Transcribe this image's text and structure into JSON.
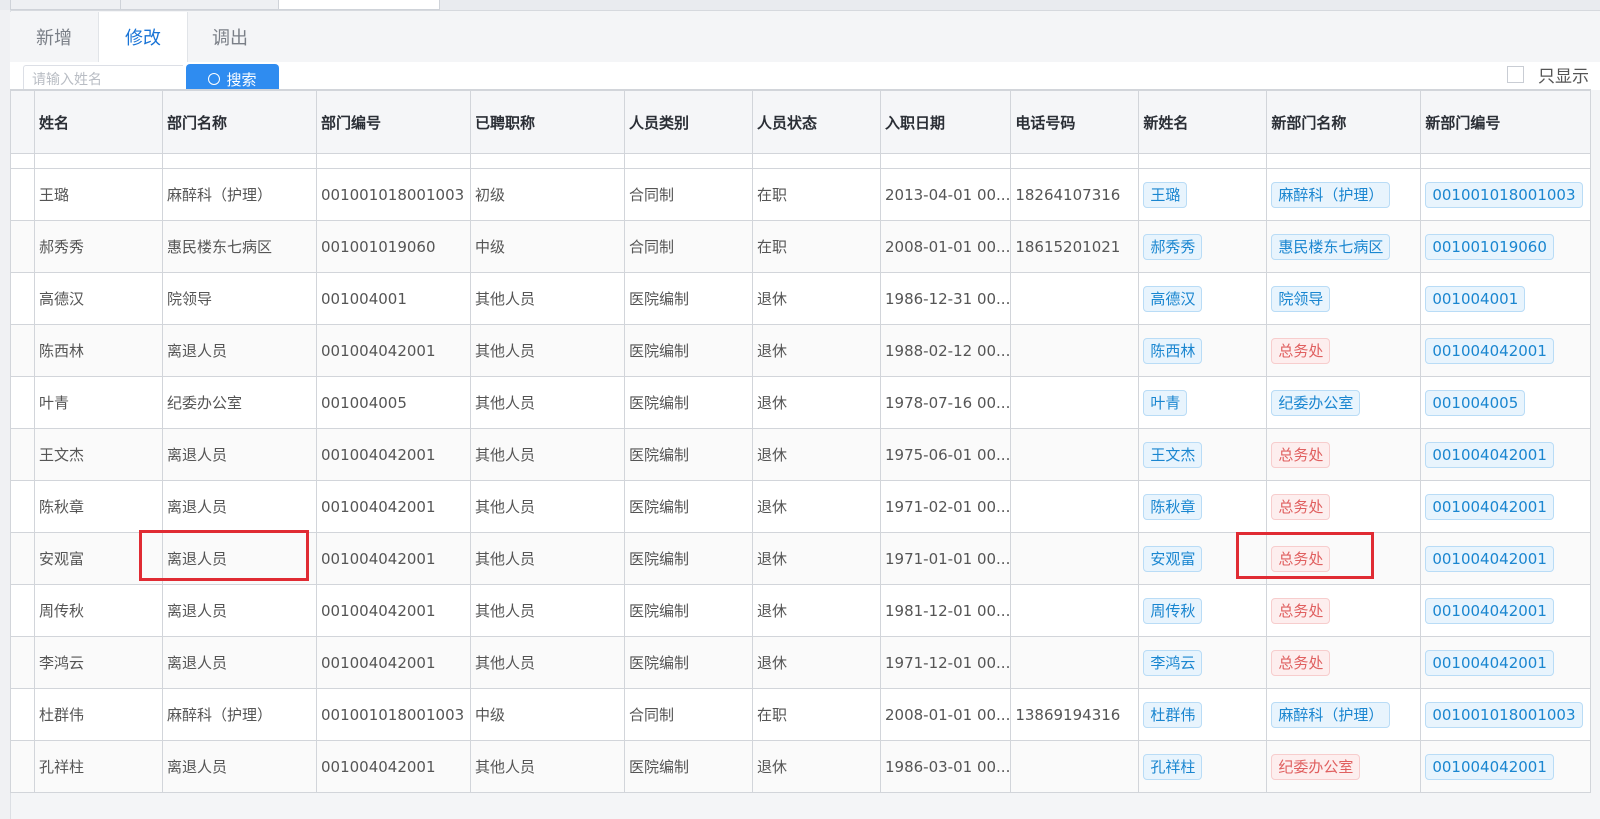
{
  "tabs": [
    {
      "label": "新增",
      "active": false
    },
    {
      "label": "修改",
      "active": true
    },
    {
      "label": "调出",
      "active": false
    }
  ],
  "search": {
    "placeholder": "请输入姓名",
    "button_label": "搜索",
    "only_show_label": "只显示"
  },
  "columns": [
    "姓名",
    "部门名称",
    "部门编号",
    "已聘职称",
    "人员类别",
    "人员状态",
    "入职日期",
    "电话号码",
    "新姓名",
    "新部门名称",
    "新部门编号"
  ],
  "rows": [
    {
      "name": "王璐",
      "dept": "麻醉科（护理）",
      "dept_no": "001001018001003",
      "title": "初级",
      "category": "合同制",
      "status": "在职",
      "date": "2013-04-01 00...",
      "phone": "18264107316",
      "new_name": "王璐",
      "new_dept": "麻醉科（护理）",
      "new_dept_no": "001001018001003",
      "new_dept_color": "blue"
    },
    {
      "name": "郝秀秀",
      "dept": "惠民楼东七病区",
      "dept_no": "001001019060",
      "title": "中级",
      "category": "合同制",
      "status": "在职",
      "date": "2008-01-01 00...",
      "phone": "18615201021",
      "new_name": "郝秀秀",
      "new_dept": "惠民楼东七病区",
      "new_dept_no": "001001019060",
      "new_dept_color": "blue"
    },
    {
      "name": "高德汉",
      "dept": "院领导",
      "dept_no": "001004001",
      "title": "其他人员",
      "category": "医院编制",
      "status": "退休",
      "date": "1986-12-31 00...",
      "phone": "",
      "new_name": "高德汉",
      "new_dept": "院领导",
      "new_dept_no": "001004001",
      "new_dept_color": "blue"
    },
    {
      "name": "陈西林",
      "dept": "离退人员",
      "dept_no": "001004042001",
      "title": "其他人员",
      "category": "医院编制",
      "status": "退休",
      "date": "1988-02-12 00...",
      "phone": "",
      "new_name": "陈西林",
      "new_dept": "总务处",
      "new_dept_no": "001004042001",
      "new_dept_color": "red"
    },
    {
      "name": "叶青",
      "dept": "纪委办公室",
      "dept_no": "001004005",
      "title": "其他人员",
      "category": "医院编制",
      "status": "退休",
      "date": "1978-07-16 00...",
      "phone": "",
      "new_name": "叶青",
      "new_dept": "纪委办公室",
      "new_dept_no": "001004005",
      "new_dept_color": "blue"
    },
    {
      "name": "王文杰",
      "dept": "离退人员",
      "dept_no": "001004042001",
      "title": "其他人员",
      "category": "医院编制",
      "status": "退休",
      "date": "1975-06-01 00...",
      "phone": "",
      "new_name": "王文杰",
      "new_dept": "总务处",
      "new_dept_no": "001004042001",
      "new_dept_color": "red"
    },
    {
      "name": "陈秋章",
      "dept": "离退人员",
      "dept_no": "001004042001",
      "title": "其他人员",
      "category": "医院编制",
      "status": "退休",
      "date": "1971-02-01 00...",
      "phone": "",
      "new_name": "陈秋章",
      "new_dept": "总务处",
      "new_dept_no": "001004042001",
      "new_dept_color": "red"
    },
    {
      "name": "安观富",
      "dept": "离退人员",
      "dept_no": "001004042001",
      "title": "其他人员",
      "category": "医院编制",
      "status": "退休",
      "date": "1971-01-01 00...",
      "phone": "",
      "new_name": "安观富",
      "new_dept": "总务处",
      "new_dept_no": "001004042001",
      "new_dept_color": "red"
    },
    {
      "name": "周传秋",
      "dept": "离退人员",
      "dept_no": "001004042001",
      "title": "其他人员",
      "category": "医院编制",
      "status": "退休",
      "date": "1981-12-01 00...",
      "phone": "",
      "new_name": "周传秋",
      "new_dept": "总务处",
      "new_dept_no": "001004042001",
      "new_dept_color": "red"
    },
    {
      "name": "李鸿云",
      "dept": "离退人员",
      "dept_no": "001004042001",
      "title": "其他人员",
      "category": "医院编制",
      "status": "退休",
      "date": "1971-12-01 00...",
      "phone": "",
      "new_name": "李鸿云",
      "new_dept": "总务处",
      "new_dept_no": "001004042001",
      "new_dept_color": "red"
    },
    {
      "name": "杜群伟",
      "dept": "麻醉科（护理）",
      "dept_no": "001001018001003",
      "title": "中级",
      "category": "合同制",
      "status": "在职",
      "date": "2008-01-01 00...",
      "phone": "13869194316",
      "new_name": "杜群伟",
      "new_dept": "麻醉科（护理）",
      "new_dept_no": "001001018001003",
      "new_dept_color": "blue"
    },
    {
      "name": "孔祥柱",
      "dept": "离退人员",
      "dept_no": "001004042001",
      "title": "其他人员",
      "category": "医院编制",
      "status": "退休",
      "date": "1986-03-01 00...",
      "phone": "",
      "new_name": "孔祥柱",
      "new_dept": "纪委办公室",
      "new_dept_no": "001004042001",
      "new_dept_color": "red"
    }
  ],
  "colors": {
    "accent": "#2f8cf0",
    "tag_blue": "#1a86d0",
    "tag_red": "#e06060",
    "highlight": "#e02b33"
  }
}
